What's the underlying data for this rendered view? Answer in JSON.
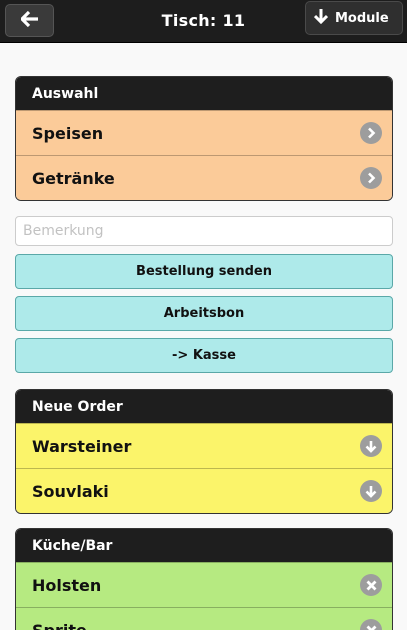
{
  "header": {
    "title": "Tisch: 11",
    "module_label": "Module"
  },
  "auswahl": {
    "heading": "Auswahl",
    "items": [
      {
        "label": "Speisen"
      },
      {
        "label": "Getränke"
      }
    ]
  },
  "remark": {
    "placeholder": "Bemerkung",
    "value": ""
  },
  "actions": {
    "send": "Bestellung senden",
    "workslip": "Arbeitsbon",
    "checkout": "-> Kasse"
  },
  "new_order": {
    "heading": "Neue Order",
    "items": [
      {
        "label": "Warsteiner"
      },
      {
        "label": "Souvlaki"
      }
    ]
  },
  "kitchen_bar": {
    "heading": "Küche/Bar",
    "items": [
      {
        "label": "Holsten"
      },
      {
        "label": "Sprite"
      }
    ]
  },
  "icons": {
    "back": "arrow-left-icon",
    "module": "arrow-down-icon",
    "navigate": "chevron-right-icon",
    "move_down": "arrow-down-circle-icon",
    "remove": "close-circle-icon"
  },
  "colors": {
    "header_bg": "#1d1d1d",
    "auswahl_row": "#fbcb99",
    "action_button": "#aeeaea",
    "new_order_row": "#fbf46a",
    "kitchen_row": "#b6ea81",
    "icon_circle": "#9d9d9d"
  }
}
